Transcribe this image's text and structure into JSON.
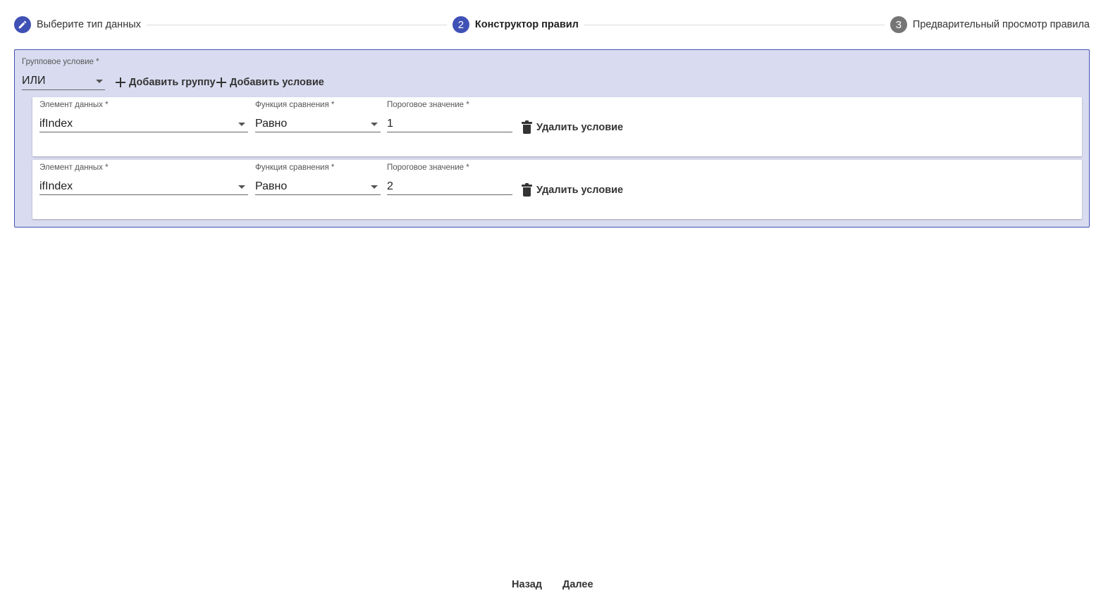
{
  "stepper": {
    "steps": [
      {
        "number": "",
        "label": "Выберите тип данных",
        "icon": "edit-pencil-icon",
        "state": "done"
      },
      {
        "number": "2",
        "label": "Конструктор правил",
        "state": "active"
      },
      {
        "number": "3",
        "label": "Предварительный просмотр правила",
        "state": "inactive"
      }
    ]
  },
  "group": {
    "label": "Групповое условие *",
    "operator": "ИЛИ",
    "add_group_label": "Добавить группу",
    "add_condition_label": "Добавить условие",
    "conditions": [
      {
        "element_label": "Элемент данных *",
        "element_value": "ifIndex",
        "function_label": "Функция сравнения *",
        "function_value": "Равно",
        "threshold_label": "Пороговое значение *",
        "threshold_value": "1",
        "delete_label": "Удалить условие"
      },
      {
        "element_label": "Элемент данных *",
        "element_value": "ifIndex",
        "function_label": "Функция сравнения *",
        "function_value": "Равно",
        "threshold_label": "Пороговое значение *",
        "threshold_value": "2",
        "delete_label": "Удалить условие"
      }
    ]
  },
  "footer": {
    "back_label": "Назад",
    "next_label": "Далее"
  },
  "colors": {
    "accent": "#3f51b5",
    "group_background": "#d9dcf0",
    "inactive_step": "#757575"
  }
}
